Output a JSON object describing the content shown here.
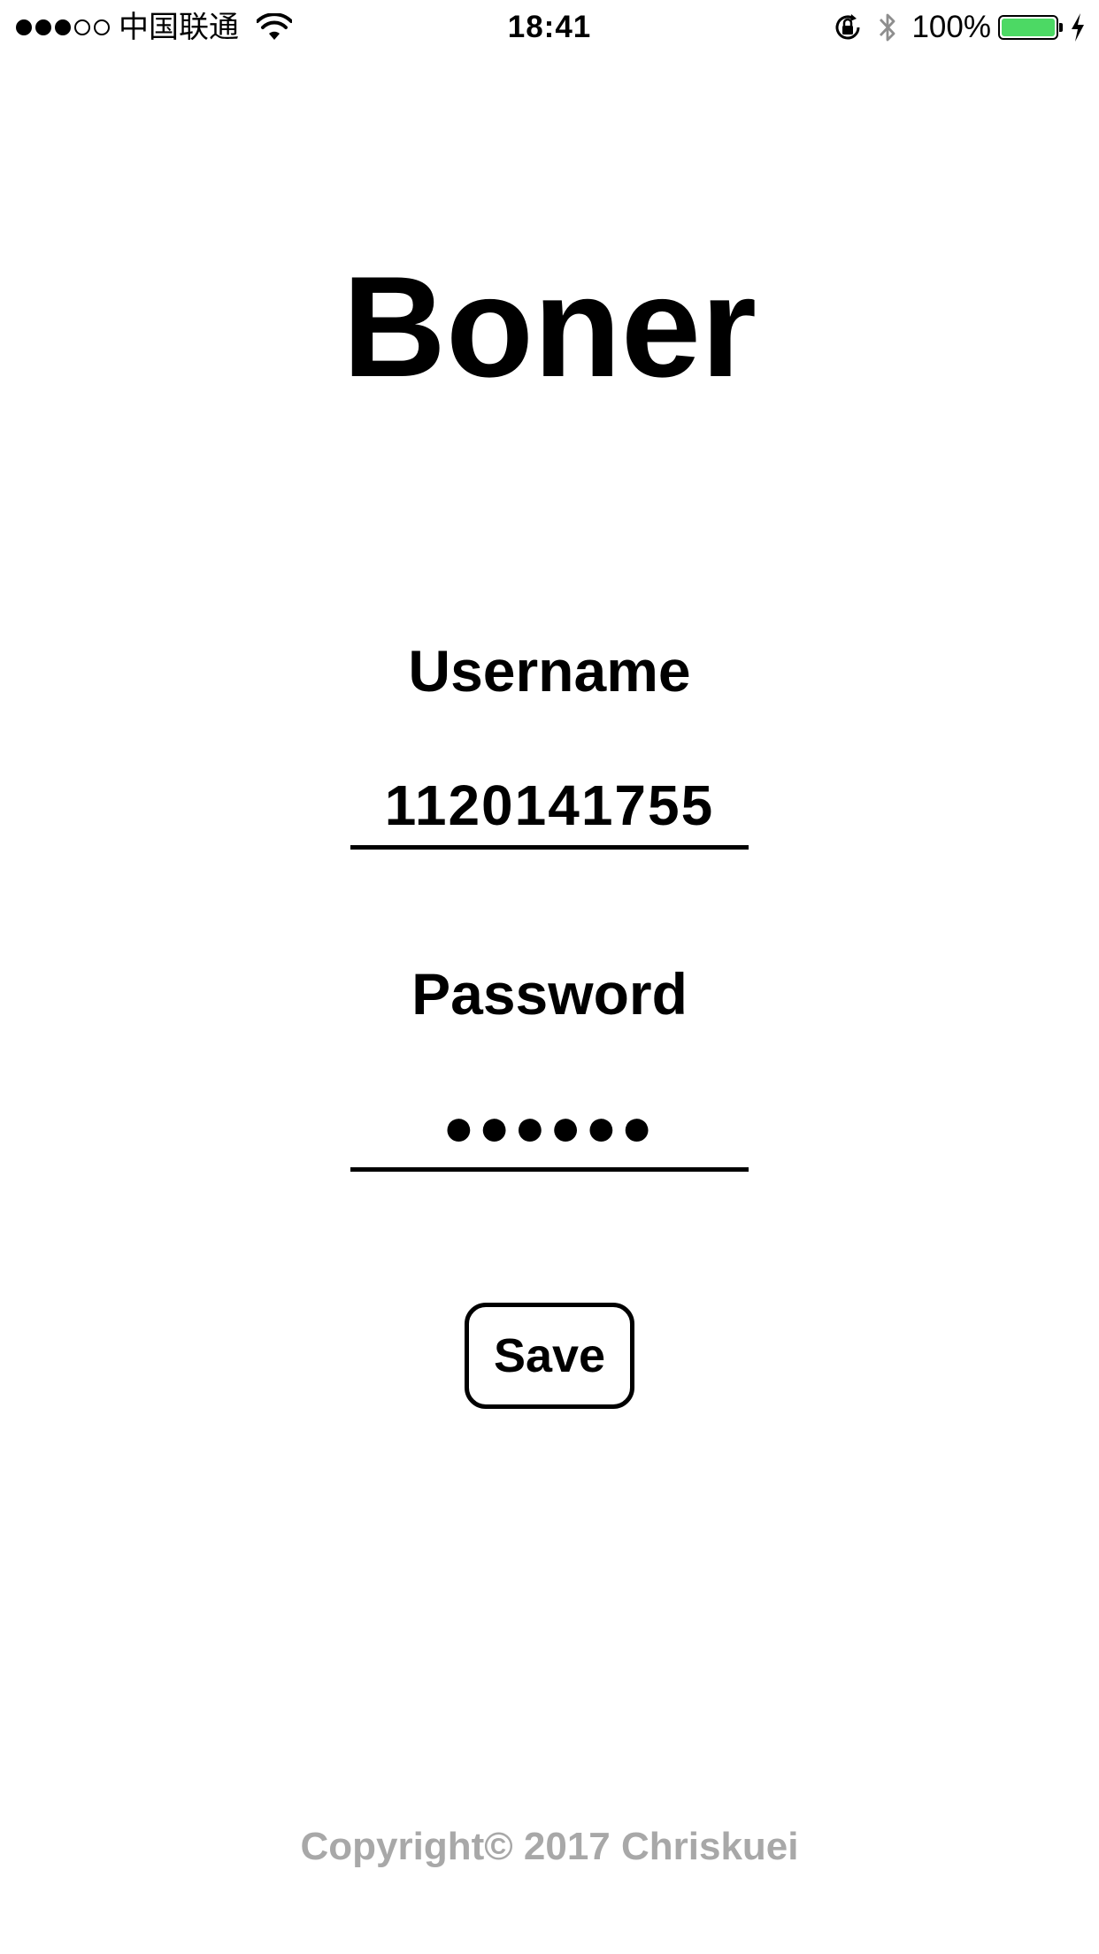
{
  "status_bar": {
    "carrier": "中国联通",
    "time": "18:41",
    "battery_percent": "100%",
    "battery_level": 1.0,
    "signal_bars_filled": 3,
    "signal_bars_total": 5,
    "icons": [
      "wifi-icon",
      "rotation-lock-icon",
      "bluetooth-icon",
      "battery-icon",
      "charging-bolt-icon"
    ],
    "battery_color": "#4cd964"
  },
  "app": {
    "title": "Boner"
  },
  "form": {
    "username_label": "Username",
    "username_value": "1120141755",
    "password_label": "Password",
    "password_value": "●●●●●●",
    "save_label": "Save"
  },
  "footer": {
    "copyright": "Copyright© 2017 Chriskuei",
    "color": "#a8a8a8"
  }
}
